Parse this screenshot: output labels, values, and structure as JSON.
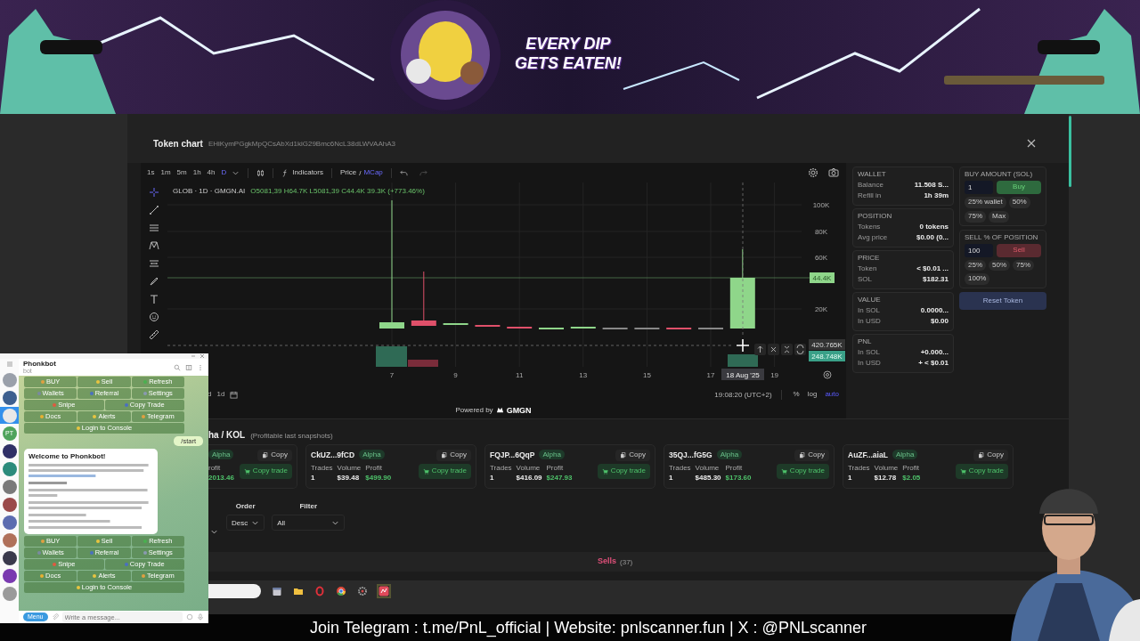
{
  "banner": {
    "slogan": [
      "EVERY DIP",
      "GETS EATEN!"
    ]
  },
  "modal": {
    "title": "Token chart",
    "address": "EHiKymPGgkMpQCsAbXd1kiG29Bmc6NcL38dLWVAAhA3"
  },
  "chart_toolbar": {
    "timeframes": [
      {
        "label": "1s",
        "selected": false
      },
      {
        "label": "1m",
        "selected": false
      },
      {
        "label": "5m",
        "selected": false
      },
      {
        "label": "1h",
        "selected": false
      },
      {
        "label": "4h",
        "selected": false
      },
      {
        "label": "D",
        "selected": true
      }
    ],
    "indicators": "Indicators",
    "separator": "/",
    "modes": [
      {
        "label": "Price",
        "selected": false
      },
      {
        "label": "MCap",
        "selected": true
      }
    ]
  },
  "legend": {
    "symbol": "GLOB · 1D · GMGN.AI",
    "ohlc": "O5081,39 H64.7K L5081,39 C44.4K 39.3K (+773.46%)"
  },
  "y_ticks": [
    "100K",
    "80K",
    "60K",
    "20K"
  ],
  "x_ticks": [
    "7",
    "9",
    "11",
    "13",
    "15",
    "17",
    "19"
  ],
  "last_price": "44.4K",
  "crosshair": {
    "date": "18 Aug '25",
    "value": "420.765K",
    "volume": "248.748K"
  },
  "range_buttons": [
    "d",
    "1d"
  ],
  "chart_footer": {
    "time": "19:08:20 (UTC+2)",
    "scales": [
      {
        "label": "%",
        "selected": false
      },
      {
        "label": "log",
        "selected": false
      },
      {
        "label": "auto",
        "selected": true
      }
    ]
  },
  "powered": {
    "text": "Powered by",
    "brand": "GMGN"
  },
  "panel": {
    "info_cards": [
      {
        "title": "WALLET",
        "rows": [
          {
            "label": "Balance",
            "value": "11.508 S..."
          },
          {
            "label": "Refill in",
            "value": "1h 39m"
          }
        ]
      },
      {
        "title": "POSITION",
        "rows": [
          {
            "label": "Tokens",
            "value": "0 tokens"
          },
          {
            "label": "Avg price",
            "value": "$0.00 (0..."
          }
        ]
      },
      {
        "title": "PRICE",
        "rows": [
          {
            "label": "Token",
            "value": "< $0.01 ..."
          },
          {
            "label": "SOL",
            "value": "$182.31"
          }
        ]
      },
      {
        "title": "VALUE",
        "rows": [
          {
            "label": "In SOL",
            "value": "0.0000..."
          },
          {
            "label": "In USD",
            "value": "$0.00"
          }
        ]
      },
      {
        "title": "PNL",
        "rows": [
          {
            "label": "In SOL",
            "value": "+0.000..."
          },
          {
            "label": "In USD",
            "value": "+ < $0.01"
          }
        ]
      }
    ],
    "trade_cards": [
      {
        "kind": "buy",
        "title": "BUY AMOUNT (SOL)",
        "value": "1",
        "button": "Buy",
        "presets": [
          "25% wallet",
          "50%",
          "75%",
          "Max"
        ]
      },
      {
        "kind": "sell",
        "title": "SELL % OF POSITION",
        "value": "100",
        "button": "Sell",
        "presets": [
          "25%",
          "50%",
          "75%",
          "100%"
        ]
      }
    ],
    "reset": "Reset Token"
  },
  "kol": {
    "title": "ha / KOL",
    "subtitle": "(Profitable last snapshots)",
    "cards": [
      {
        "badge": "Alpha",
        "stats": [
          {
            "label": "rofit",
            "value": "2013.46"
          }
        ],
        "copy": "Copy",
        "copy_trade": "Copy trade"
      },
      {
        "name": "CkUZ...9fCD",
        "badge": "Alpha",
        "stats": [
          {
            "label": "Trades",
            "value": "1"
          },
          {
            "label": "Volume",
            "value": "$39.48"
          },
          {
            "label": "Profit",
            "value": "$499.90"
          }
        ],
        "copy": "Copy",
        "copy_trade": "Copy trade"
      },
      {
        "name": "FQJP...6QqP",
        "badge": "Alpha",
        "stats": [
          {
            "label": "Trades",
            "value": "1"
          },
          {
            "label": "Volume",
            "value": "$416.09"
          },
          {
            "label": "Profit",
            "value": "$247.93"
          }
        ],
        "copy": "Copy",
        "copy_trade": "Copy trade"
      },
      {
        "name": "35QJ...fG5G",
        "badge": "Alpha",
        "stats": [
          {
            "label": "Trades",
            "value": "1"
          },
          {
            "label": "Volume",
            "value": "$485.30"
          },
          {
            "label": "Profit",
            "value": "$173.60"
          }
        ],
        "copy": "Copy",
        "copy_trade": "Copy trade"
      },
      {
        "name": "AuZF...aiaL",
        "badge": "Alpha",
        "stats": [
          {
            "label": "Trades",
            "value": "1"
          },
          {
            "label": "Volume",
            "value": "$12.78"
          },
          {
            "label": "Profit",
            "value": "$2.05"
          }
        ],
        "copy": "Copy",
        "copy_trade": "Copy trade"
      }
    ]
  },
  "filters": [
    {
      "label": "Order",
      "value": "Desc"
    },
    {
      "label": "Filter",
      "value": "All"
    }
  ],
  "tabs": [
    {
      "label": "Sells",
      "count": "(37)",
      "selected": true
    }
  ],
  "telegram": {
    "title": "Phonkbot",
    "subtitle": "bot",
    "chats": [
      {
        "selected": false
      },
      {
        "selected": false
      },
      {
        "selected": true
      },
      {
        "selected": false,
        "initials": "PT"
      },
      {
        "selected": false
      },
      {
        "selected": false
      },
      {
        "selected": false
      },
      {
        "selected": false
      },
      {
        "selected": false
      },
      {
        "selected": false
      },
      {
        "selected": false
      },
      {
        "selected": false
      },
      {
        "selected": false
      }
    ],
    "keyboards": [
      {
        "rows": [
          {
            "buttons": [
              "BUY",
              "Sell",
              "Refresh"
            ]
          },
          {
            "buttons": [
              "Wallets",
              "Referral",
              "Settings"
            ]
          },
          {
            "buttons": [
              "Snipe",
              "Copy Trade"
            ]
          },
          {
            "buttons": [
              "Docs",
              "Alerts",
              "Telegram"
            ]
          },
          {
            "buttons": [
              "Login to Console"
            ]
          }
        ]
      },
      {
        "rows": [
          {
            "buttons": [
              "BUY",
              "Sell",
              "Refresh"
            ]
          },
          {
            "buttons": [
              "Wallets",
              "Referral",
              "Settings"
            ]
          },
          {
            "buttons": [
              "Snipe",
              "Copy Trade"
            ]
          },
          {
            "buttons": [
              "Docs",
              "Alerts",
              "Telegram"
            ]
          },
          {
            "buttons": [
              "Login to Console"
            ]
          }
        ]
      }
    ],
    "outgoing": "/start",
    "welcome": "Welcome to Phonkbot!",
    "menu": "Menu",
    "placeholder": "Write a message..."
  },
  "caption": "Join Telegram : t.me/PnL_official | Website: pnlscanner.fun |  X : @PNLscanner"
}
